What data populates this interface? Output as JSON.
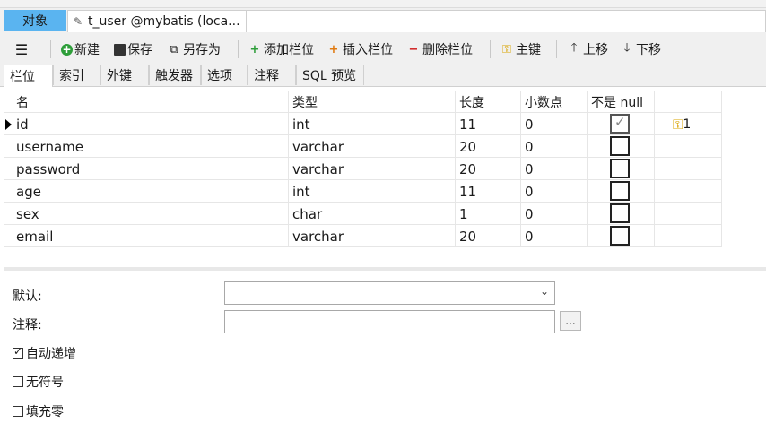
{
  "tabs": {
    "objects_label": "对象",
    "table_tab_label": "t_user @mybatis (loca..."
  },
  "toolbar": {
    "new": "新建",
    "save": "保存",
    "save_as": "另存为",
    "add_field": "添加栏位",
    "insert_field": "插入栏位",
    "delete_field": "删除栏位",
    "primary_key": "主键",
    "move_up": "上移",
    "move_down": "下移"
  },
  "subtabs": [
    "栏位",
    "索引",
    "外键",
    "触发器",
    "选项",
    "注释",
    "SQL 预览"
  ],
  "grid": {
    "headers": [
      "名",
      "类型",
      "长度",
      "小数点",
      "不是 null",
      ""
    ],
    "rows": [
      {
        "name": "id",
        "type": "int",
        "length": "11",
        "decimals": "0",
        "not_null": true,
        "key": "1"
      },
      {
        "name": "username",
        "type": "varchar",
        "length": "20",
        "decimals": "0",
        "not_null": false,
        "key": ""
      },
      {
        "name": "password",
        "type": "varchar",
        "length": "20",
        "decimals": "0",
        "not_null": false,
        "key": ""
      },
      {
        "name": "age",
        "type": "int",
        "length": "11",
        "decimals": "0",
        "not_null": false,
        "key": ""
      },
      {
        "name": "sex",
        "type": "char",
        "length": "1",
        "decimals": "0",
        "not_null": false,
        "key": ""
      },
      {
        "name": "email",
        "type": "varchar",
        "length": "20",
        "decimals": "0",
        "not_null": false,
        "key": ""
      }
    ]
  },
  "properties": {
    "default_label": "默认:",
    "default_value": "",
    "comment_label": "注释:",
    "comment_value": "",
    "more_label": "...",
    "auto_increment_label": "自动递增",
    "auto_increment": true,
    "unsigned_label": "无符号",
    "unsigned": false,
    "zerofill_label": "填充零",
    "zerofill": false
  },
  "icons": {
    "menu": "hamburger-icon",
    "new": "new-plus-icon",
    "save": "floppy-icon",
    "save_as": "copy-icon",
    "primary_key": "key-icon"
  }
}
